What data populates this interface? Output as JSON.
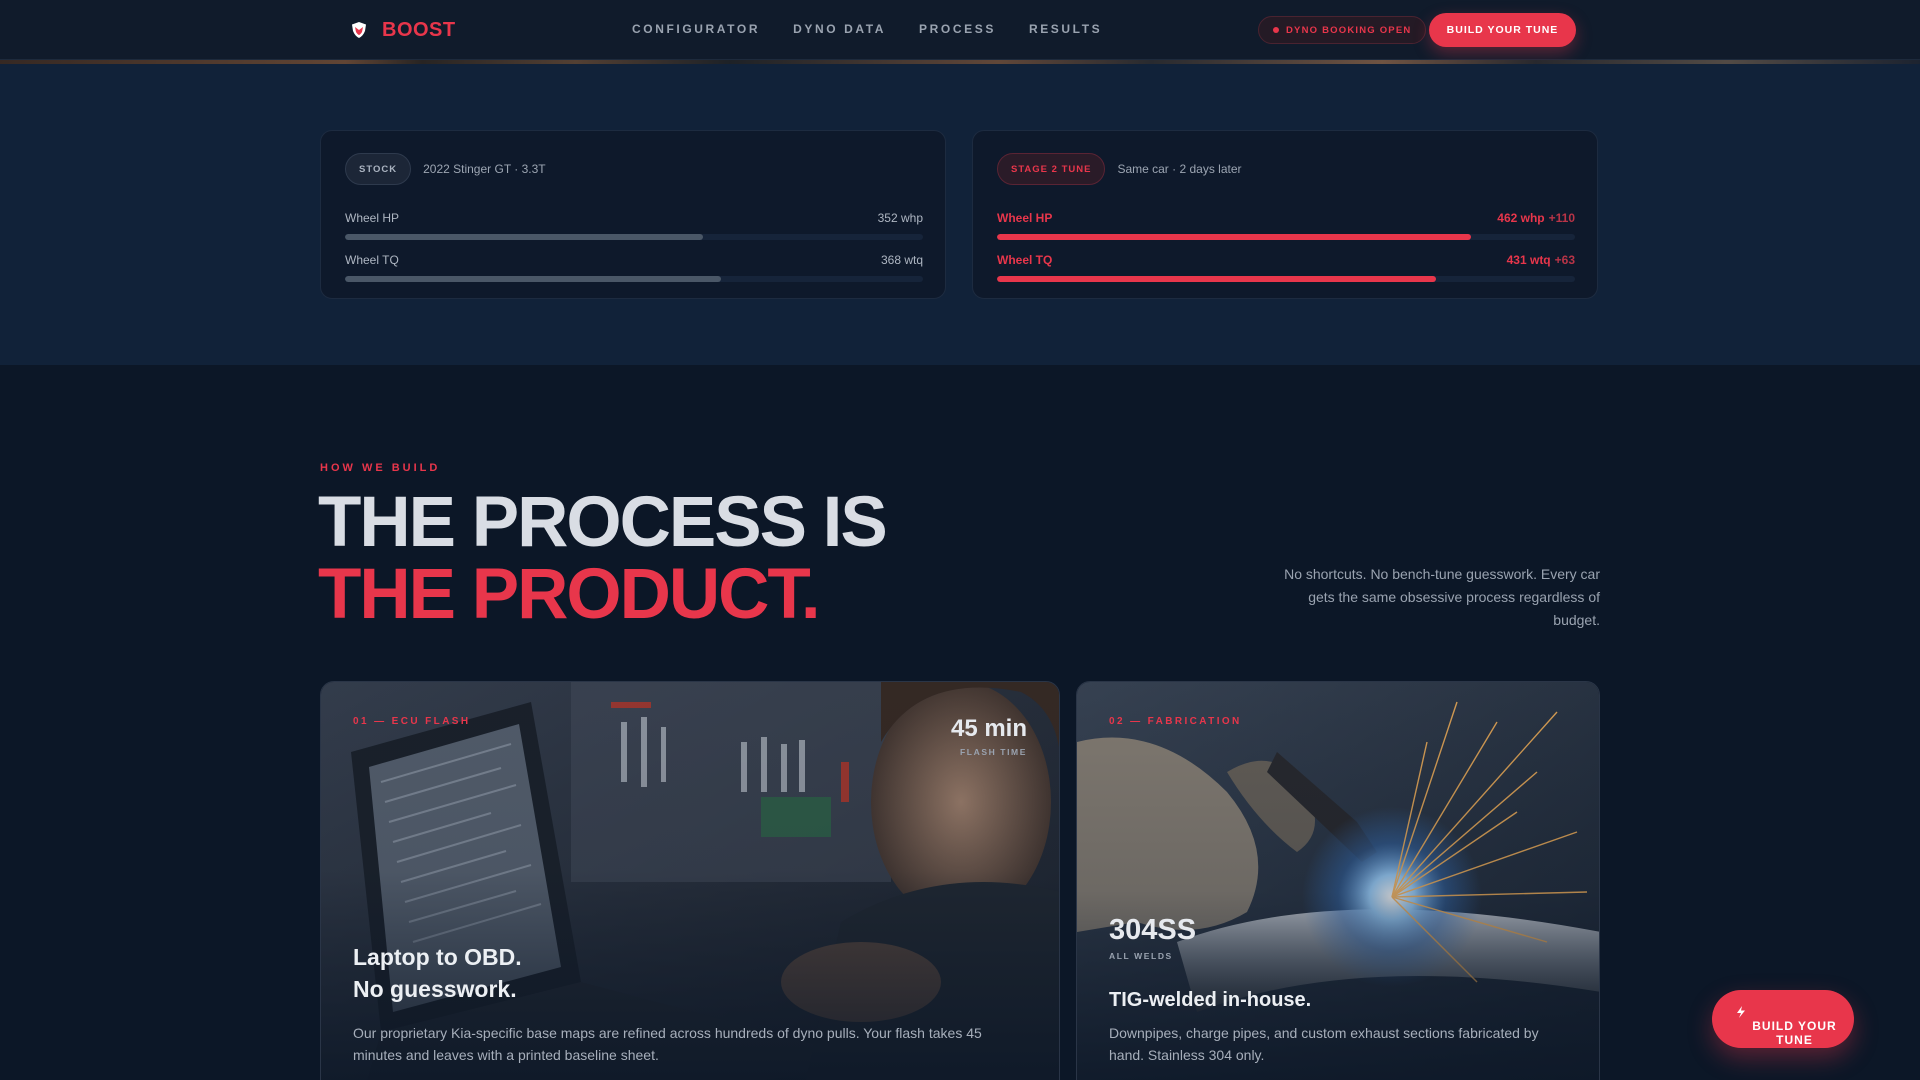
{
  "nav": {
    "brand": "BOOST",
    "links": [
      "CONFIGURATOR",
      "DYNO DATA",
      "PROCESS",
      "RESULTS"
    ],
    "booking_status": "DYNO BOOKING OPEN",
    "cta": "BUILD YOUR TUNE"
  },
  "compare": {
    "stock": {
      "chip": "STOCK",
      "subtitle": "2022 Stinger GT · 3.3T",
      "metrics": [
        {
          "label": "Wheel HP",
          "value": "352 whp",
          "fill": 0.62
        },
        {
          "label": "Wheel TQ",
          "value": "368 wtq",
          "fill": 0.65
        }
      ]
    },
    "tuned": {
      "chip": "STAGE 2 TUNE",
      "subtitle": "Same car · 2 days later",
      "metrics": [
        {
          "label": "Wheel HP",
          "value": "462 whp",
          "delta": "+110",
          "fill": 0.82
        },
        {
          "label": "Wheel TQ",
          "value": "431 wtq",
          "delta": "+63",
          "fill": 0.76
        }
      ]
    }
  },
  "process": {
    "eyebrow": "HOW WE BUILD",
    "headline_1": "THE PROCESS IS",
    "headline_2": "THE PRODUCT.",
    "intro": "No shortcuts. No bench-tune guesswork. Every car gets the same obsessive process regardless of budget.",
    "tiles": [
      {
        "tag": "01 — ECU FLASH",
        "stat": "45 min",
        "stat_caption": "FLASH TIME",
        "title_1": "Laptop to OBD.",
        "title_2": "No guesswork.",
        "desc": "Our proprietary Kia-specific base maps are refined across hundreds of dyno pulls. Your flash takes 45 minutes and leaves with a printed baseline sheet."
      },
      {
        "tag": "02 — FABRICATION",
        "stat": "304SS",
        "stat_caption": "ALL WELDS",
        "title": "TIG-welded in-house.",
        "desc": "Downpipes, charge pipes, and custom exhaust sections fabricated by hand. Stainless 304 only."
      }
    ]
  },
  "floating_cta": "BUILD YOUR TUNE",
  "colors": {
    "accent": "#e8364b",
    "bg": "#0d1a2c",
    "panel": "#112239"
  }
}
